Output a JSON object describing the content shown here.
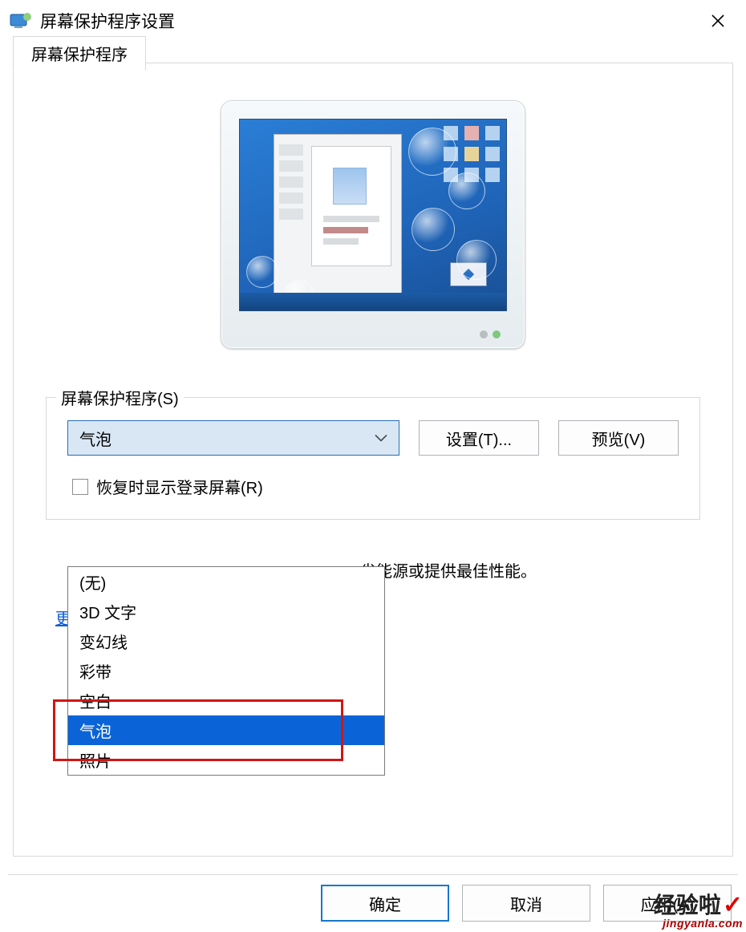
{
  "titlebar": {
    "title": "屏幕保护程序设置"
  },
  "tab": {
    "label": "屏幕保护程序"
  },
  "group": {
    "legend": "屏幕保护程序(S)",
    "selected": "气泡",
    "settings_btn": "设置(T)...",
    "preview_btn": "预览(V)",
    "resume_label": "恢复时显示登录屏幕(R)"
  },
  "dropdown_options": [
    "(无)",
    "3D 文字",
    "变幻线",
    "彩带",
    "空白",
    "气泡",
    "照片"
  ],
  "dropdown_selected_index": 5,
  "power": {
    "desc_suffix": "省能源或提供最佳性能。",
    "link": "更改电源设置"
  },
  "buttons": {
    "ok": "确定",
    "cancel": "取消",
    "apply": "应用(A)"
  },
  "watermark": {
    "brand": "经验啦",
    "url": "jingyanla.com"
  }
}
